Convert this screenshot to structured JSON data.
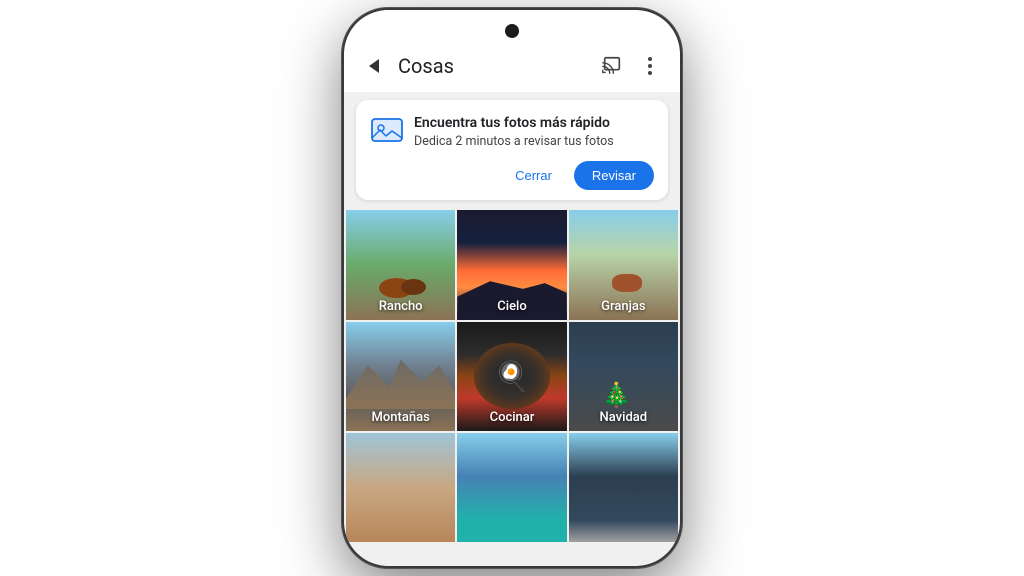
{
  "phone": {
    "topBar": {
      "title": "Cosas",
      "backLabel": "back",
      "castLabel": "cast",
      "moreLabel": "more options"
    },
    "notification": {
      "title": "Encuentra tus fotos más rápido",
      "subtitle": "Dedica 2 minutos a revisar tus fotos",
      "closeButton": "Cerrar",
      "reviewButton": "Revisar"
    },
    "grid": {
      "row1": [
        {
          "label": "Rancho",
          "colorClass": "photo-rancho"
        },
        {
          "label": "Cielo",
          "colorClass": "photo-cielo"
        },
        {
          "label": "Granjas",
          "colorClass": "photo-granjas"
        }
      ],
      "row2": [
        {
          "label": "Montañas",
          "colorClass": "photo-montanas"
        },
        {
          "label": "Cocinar",
          "colorClass": "photo-cocinar"
        },
        {
          "label": "Navidad",
          "colorClass": "photo-navidad"
        }
      ],
      "row3": [
        {
          "label": "",
          "colorClass": "photo-row3-1"
        },
        {
          "label": "",
          "colorClass": "photo-row3-2"
        },
        {
          "label": "",
          "colorClass": "photo-row3-3"
        }
      ]
    }
  }
}
